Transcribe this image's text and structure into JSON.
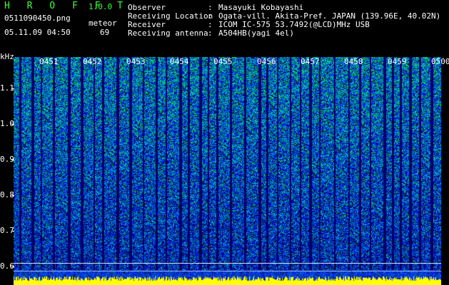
{
  "header": {
    "app_name": "H R O F F T",
    "version": "1.0.0",
    "filename": "0511090450.png",
    "datetime": "05.11.09 04:50",
    "mode_label": "meteor",
    "count": "69"
  },
  "info": [
    {
      "label": "Observer",
      "value": "Masayuki Kobayashi"
    },
    {
      "label": "Receiving Location",
      "value": "Ogata-vill. Akita-Pref. JAPAN (139.96E, 40.02N)"
    },
    {
      "label": "Receiver",
      "value": "ICOM IC-575 53.7492(@LCD)MHz USB"
    },
    {
      "label": "Receiving antenna",
      "value": "A504HB(yagi 4el)"
    }
  ],
  "y_axis": {
    "unit": "kHz",
    "ticks": [
      "1.1",
      "1.0",
      "0.9",
      "0.8",
      "0.7",
      "0.6"
    ]
  },
  "x_axis": {
    "ticks": [
      "0451",
      "0452",
      "0453",
      "0454",
      "0455",
      "0456",
      "0457",
      "0458",
      "0459",
      "0500"
    ]
  },
  "colors": {
    "label_green": "#3dff3d",
    "background": "#000000",
    "baseline_yellow": "#ffff00"
  }
}
